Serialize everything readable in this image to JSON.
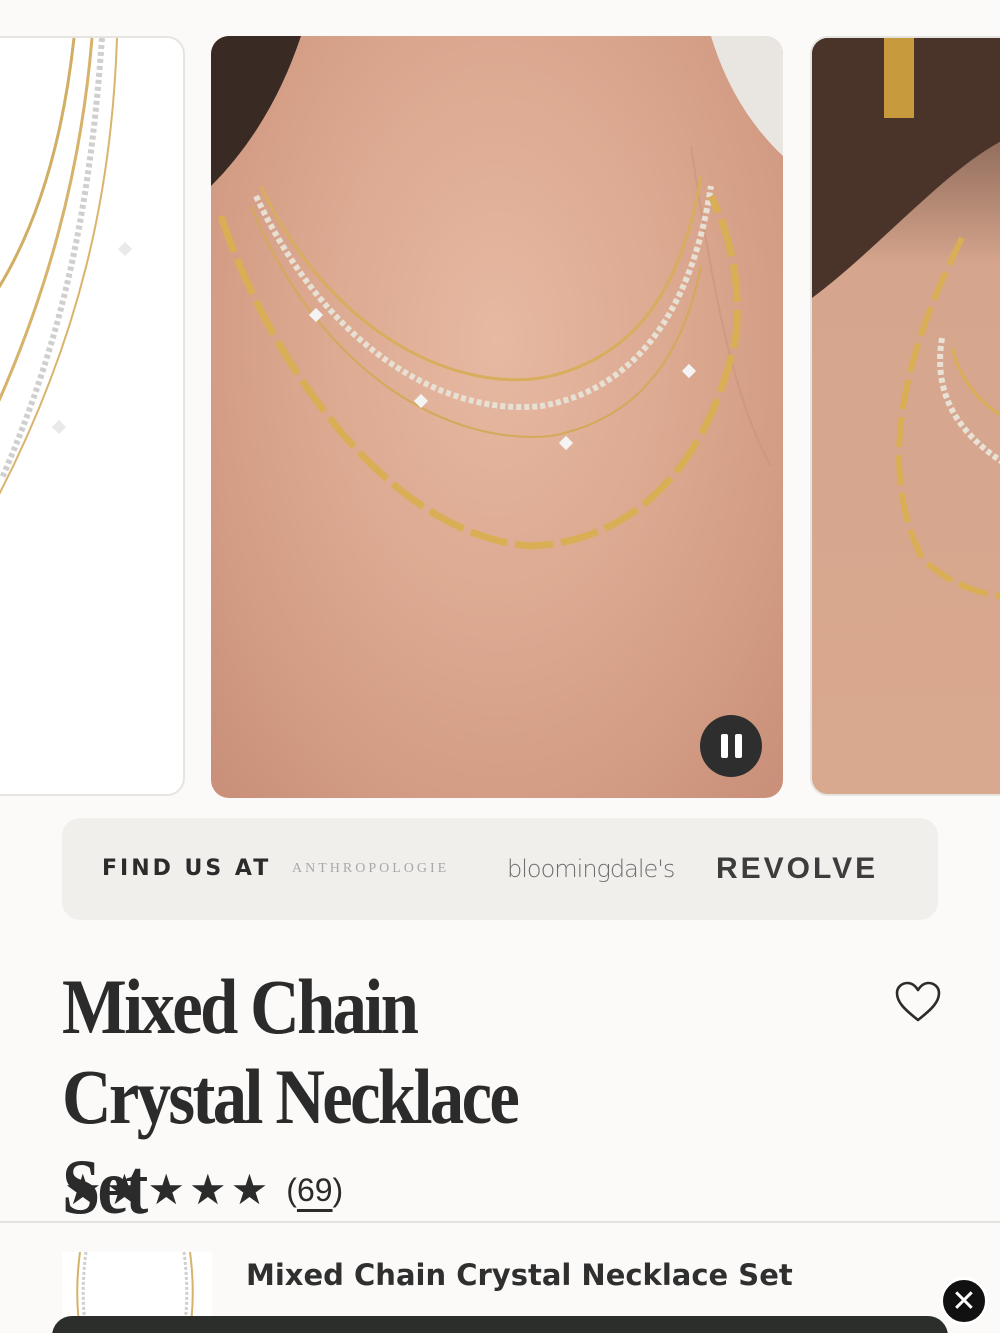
{
  "carousel": {
    "images": [
      {
        "alt": "necklace-product-flat"
      },
      {
        "alt": "necklace-on-model"
      },
      {
        "alt": "necklace-on-model-side"
      }
    ],
    "pause_icon": "pause-icon"
  },
  "find_us": {
    "label": "FIND US AT",
    "brands": [
      "ANTHROPOLOGIE",
      "bloomingdale's",
      "REVOLVE"
    ]
  },
  "product": {
    "title": "Mixed Chain Crystal Necklace Set",
    "rating": 5,
    "rating_max": 5,
    "review_count_open": "(",
    "review_count": "69",
    "review_count_close": ")",
    "wishlist_icon": "heart-outline-icon"
  },
  "sticky": {
    "title": "Mixed Chain Crystal Necklace Set",
    "subtitle": "",
    "close_icon": "close-icon"
  },
  "colors": {
    "background": "#fbfaf9",
    "text": "#2b2b2b",
    "panel": "#f1efec",
    "bar": "#2c2e2b"
  }
}
